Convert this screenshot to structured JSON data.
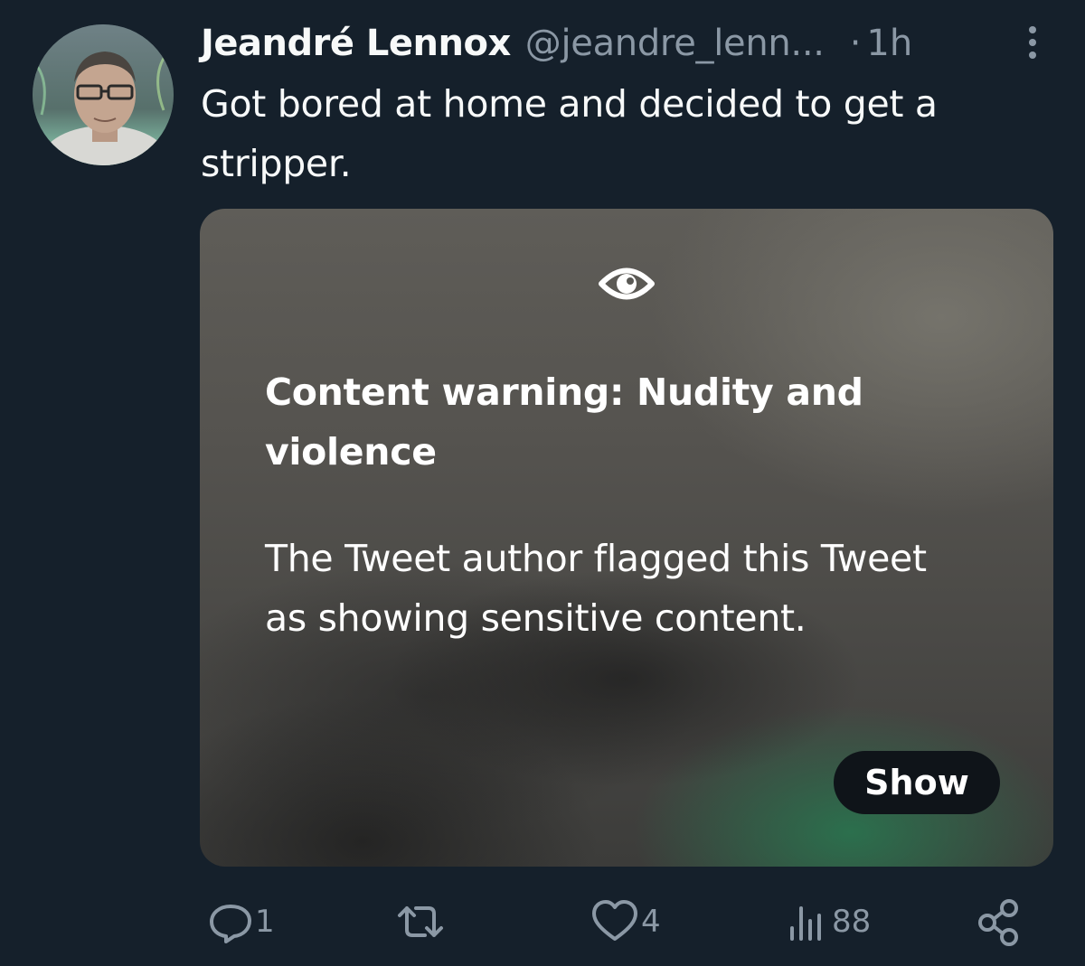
{
  "author": {
    "display_name": "Jeandré Lennox",
    "handle": "@jeandre_lenn...",
    "separator": "·",
    "time": "1h"
  },
  "tweet": {
    "text": "Got bored at home and decided to get a stripper."
  },
  "media_warning": {
    "title": "Content warning: Nudity and violence",
    "body": "The Tweet author flagged this Tweet as showing sensitive content.",
    "show_label": "Show"
  },
  "actions": {
    "replies": "1",
    "retweets": "",
    "likes": "4",
    "views": "88"
  },
  "colors": {
    "background": "#15202b",
    "primary_text": "#f7f9f9",
    "secondary_text": "#8b98a5",
    "button_bg": "#0f1419"
  },
  "icons": [
    "more-vertical-icon",
    "eye-icon",
    "reply-icon",
    "retweet-icon",
    "like-icon",
    "views-icon",
    "share-icon"
  ]
}
